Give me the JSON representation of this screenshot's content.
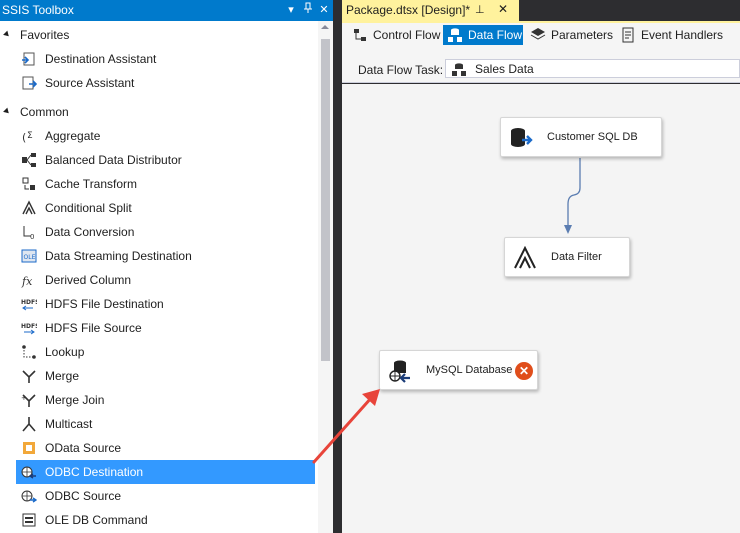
{
  "toolbox": {
    "title": "SSIS Toolbox",
    "groups": [
      {
        "name": "Favorites",
        "items": [
          "Destination Assistant",
          "Source Assistant"
        ]
      },
      {
        "name": "Common",
        "items": [
          "Aggregate",
          "Balanced Data Distributor",
          "Cache Transform",
          "Conditional Split",
          "Data Conversion",
          "Data Streaming Destination",
          "Derived Column",
          "HDFS File Destination",
          "HDFS File Source",
          "Lookup",
          "Merge",
          "Merge Join",
          "Multicast",
          "OData Source",
          "ODBC Destination",
          "ODBC Source",
          "OLE DB Command"
        ]
      }
    ],
    "selected_item": "ODBC Destination",
    "pin_glyph": "▾ ⊥",
    "close_glyph": "✕"
  },
  "document": {
    "tab_title": "Package.dtsx [Design]*",
    "tab_pin_glyph": "⊥",
    "tab_close_glyph": "✕"
  },
  "design_tabs": [
    {
      "label": "Control Flow",
      "icon": "control-flow-icon",
      "active": false
    },
    {
      "label": "Data Flow",
      "icon": "data-flow-icon",
      "active": true
    },
    {
      "label": "Parameters",
      "icon": "parameters-icon",
      "active": false
    },
    {
      "label": "Event Handlers",
      "icon": "event-handlers-icon",
      "active": false
    }
  ],
  "data_flow_task": {
    "label": "Data Flow Task:",
    "value": "Sales Data"
  },
  "components": [
    {
      "name": "Customer SQL DB",
      "icon": "database-source-icon"
    },
    {
      "name": "Data Filter",
      "icon": "conditional-split-icon"
    },
    {
      "name": "MySQL Database",
      "icon": "odbc-destination-icon",
      "error": true,
      "error_glyph": "✕"
    }
  ],
  "colors": {
    "accent": "#007acc",
    "selection": "#3399ff",
    "document_tab": "#fff29d",
    "error": "#e04e1b",
    "annotation_arrow": "#e8443a",
    "connector": "#5b7db1"
  }
}
